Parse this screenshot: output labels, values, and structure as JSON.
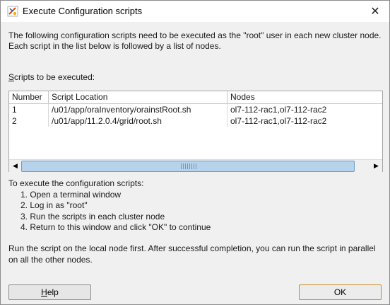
{
  "window": {
    "title": "Execute Configuration scripts",
    "close_symbol": "✕"
  },
  "description": "The following configuration scripts need to be executed as the \"root\" user in each new cluster node. Each script in the list below is followed by a list of nodes.",
  "scripts_label": {
    "mnemonic": "S",
    "rest": "cripts to be executed:"
  },
  "table": {
    "columns": [
      "Number",
      "Script Location",
      "Nodes"
    ],
    "rows": [
      [
        "1",
        "/u01/app/oraInventory/orainstRoot.sh",
        "ol7-112-rac1,ol7-112-rac2"
      ],
      [
        "2",
        "/u01/app/11.2.0.4/grid/root.sh",
        "ol7-112-rac1,ol7-112-rac2"
      ]
    ]
  },
  "scrollbar": {
    "left_arrow": "◀",
    "right_arrow": "▶"
  },
  "instructions": {
    "heading": "To execute the configuration scripts:",
    "steps": [
      "1. Open a terminal window",
      "2. Log in as \"root\"",
      "3. Run the scripts in each cluster node",
      "4. Return to this window and click \"OK\" to continue"
    ]
  },
  "note": "Run the script on the local node first. After successful completion, you can run the script in parallel on all the other nodes.",
  "buttons": {
    "help_mnemonic": "H",
    "help_rest": "elp",
    "ok": "OK"
  },
  "colors": {
    "scroll_thumb": "#b7d3ec",
    "ok_border": "#c38a1d"
  },
  "icons": [
    "oracle-installer-icon",
    "close-icon",
    "scroll-left-icon",
    "scroll-right-icon"
  ]
}
